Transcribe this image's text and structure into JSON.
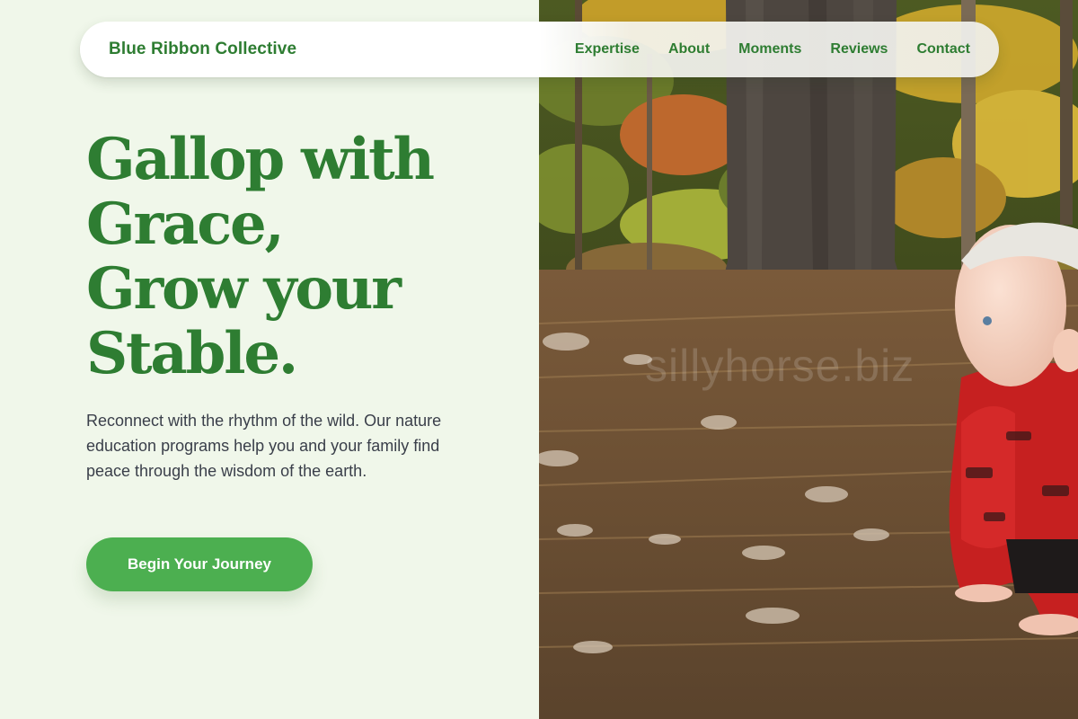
{
  "brand": {
    "name": "Blue Ribbon Collective"
  },
  "nav": {
    "links": [
      "Expertise",
      "About",
      "Moments",
      "Reviews",
      "Contact"
    ]
  },
  "hero": {
    "headline": "Gallop with\nGrace,\nGrow your\nStable.",
    "subtext": "Reconnect with the rhythm of the wild. Our nature education programs help you and your family find peace through the wisdom of the earth.",
    "cta_label": "Begin Your Journey"
  },
  "photo": {
    "subject": "baby in red hoodie crawling on forest floor with autumn trees",
    "watermark": "sillyhorse.biz"
  },
  "colors": {
    "page_background": "#f0f7ea",
    "brand_green": "#2e7d32",
    "button_green": "#4caf50",
    "body_text": "#3a3f4a"
  }
}
